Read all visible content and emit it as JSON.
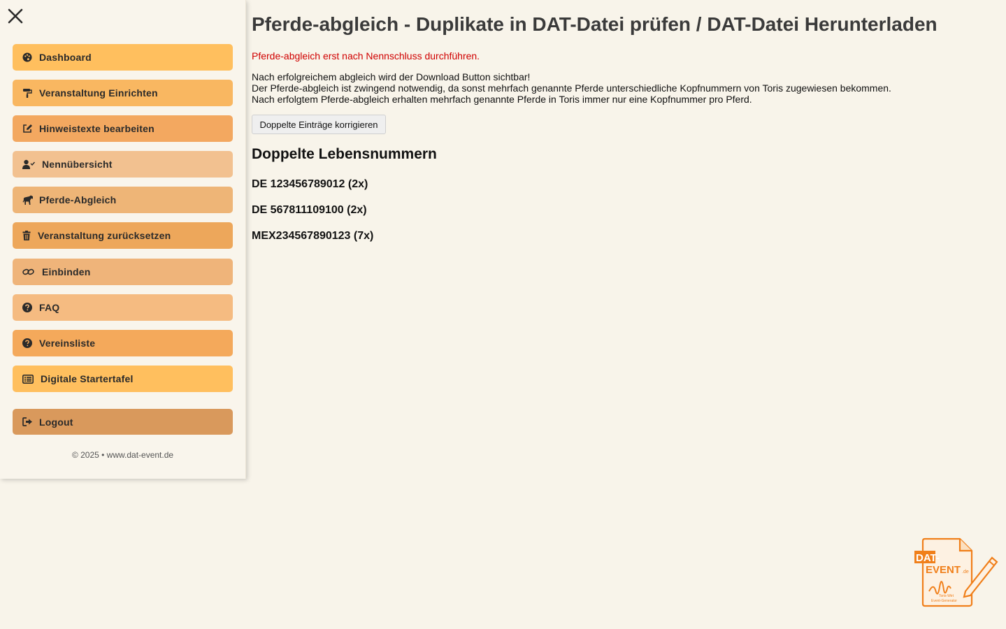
{
  "sidebar": {
    "close_icon": "close-icon",
    "items": [
      {
        "label": "Dashboard",
        "icon": "palette-icon",
        "color": "#ffbf5e"
      },
      {
        "label": "Veranstaltung Einrichten",
        "icon": "paint-roller-icon",
        "color": "#f9b761"
      },
      {
        "label": "Hinweistexte bearbeiten",
        "icon": "edit-icon",
        "color": "#f3a860"
      },
      {
        "label": "Nennübersicht",
        "icon": "user-check-icon",
        "color": "#f2c190"
      },
      {
        "label": "Pferde-Abgleich",
        "icon": "horse-icon",
        "color": "#eeb577"
      },
      {
        "label": "Veranstaltung zurücksetzen",
        "icon": "trash-icon",
        "color": "#eda75b"
      },
      {
        "label": "Einbinden",
        "icon": "link-icon",
        "color": "#efb47a"
      },
      {
        "label": "FAQ",
        "icon": "question-circle-icon",
        "color": "#f5bb81"
      },
      {
        "label": "Vereinsliste",
        "icon": "question-circle-icon",
        "color": "#f4a95b"
      },
      {
        "label": "Digitale Startertafel",
        "icon": "list-icon",
        "color": "#ffbf5e"
      }
    ],
    "logout": {
      "label": "Logout",
      "icon": "sign-out-icon",
      "color": "#d9995c"
    },
    "copyright": "© 2025 • www.dat-event.de"
  },
  "main": {
    "title": "Pferde-abgleich - Duplikate in DAT-Datei prüfen / DAT-Datei Herunterladen",
    "warning": "Pferde-abgleich erst nach Nennschluss durchführen.",
    "warning_color": "#d00000",
    "info_lines": [
      "Nach erfolgreichem abgleich wird der Download Button sichtbar!",
      "Der Pferde-abgleich ist zwingend notwendig, da sonst mehrfach genannte Pferde unterschiedliche Kopfnummern von Toris zugewiesen bekommen.",
      "Nach erfolgtem Pferde-abgleich erhalten mehrfach genannte Pferde in Toris immer nur eine Kopfnummer pro Pferd."
    ],
    "fix_button": "Doppelte Einträge korrigieren",
    "section_title": "Doppelte Lebensnummern",
    "duplicates": [
      "DE 123456789012 (2x)",
      "DE 567811109100 (2x)",
      "MEX234567890123 (7x)"
    ]
  },
  "logo": {
    "line1": "DAT-",
    "line2": "EVENT",
    "suffix": ".de",
    "tagline1": "Toris-Wirt",
    "tagline2": "Event-Generator",
    "color": "#f07f1a"
  }
}
